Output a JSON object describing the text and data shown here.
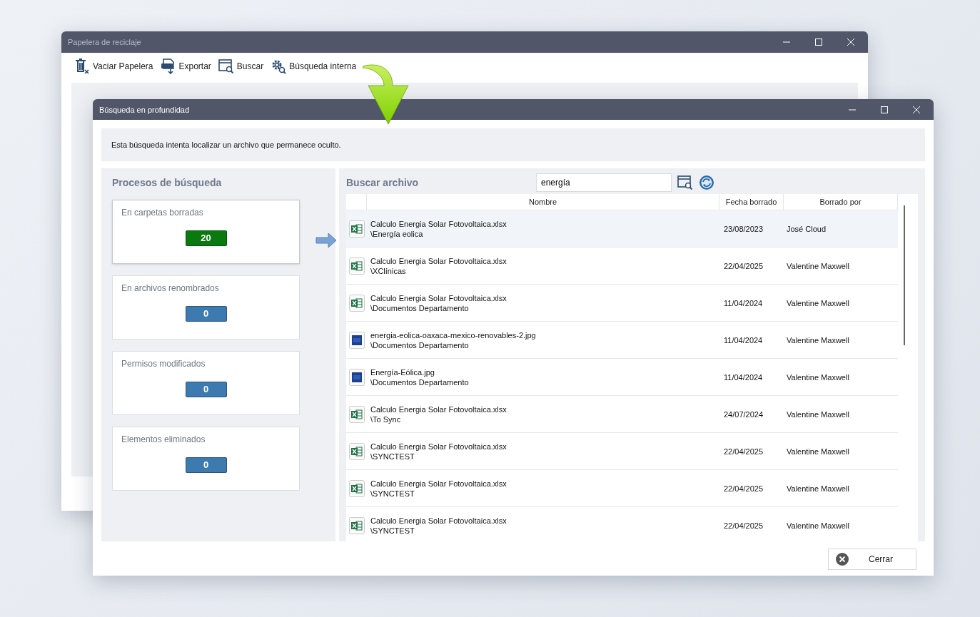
{
  "back_window": {
    "title": "Papelera de reciclaje",
    "toolbar": [
      {
        "kind": "trash",
        "label": "Vaciar Papelera"
      },
      {
        "kind": "csv",
        "label": "Exportar"
      },
      {
        "kind": "search",
        "label": "Buscar"
      },
      {
        "kind": "gear",
        "label": "Búsqueda interna"
      }
    ]
  },
  "dialog": {
    "title": "Búsqueda en profundidad",
    "info": "Esta búsqueda intenta localizar un archivo que permanece oculto.",
    "processes": {
      "title": "Procesos de búsqueda",
      "cards": [
        {
          "label": "En carpetas borradas",
          "count": "20",
          "color": "#0a7a10",
          "selected": true
        },
        {
          "label": "En archivos renombrados",
          "count": "0",
          "color": "#3c7ab0",
          "selected": false
        },
        {
          "label": "Permisos modificados",
          "count": "0",
          "color": "#3c7ab0",
          "selected": false
        },
        {
          "label": "Elementos eliminados",
          "count": "0",
          "color": "#3c7ab0",
          "selected": false
        }
      ]
    },
    "search": {
      "title": "Buscar archivo",
      "value": "energía"
    },
    "table": {
      "columns": [
        "Nombre",
        "Fecha borrado",
        "Borrado por"
      ],
      "rows": [
        {
          "kind": "excel",
          "name": "Calculo Energia Solar Fotovoltaica.xlsx",
          "path": "\\Energía eolica",
          "date": "23/08/2023",
          "by": "José Cloud",
          "selected": true
        },
        {
          "kind": "excel",
          "name": "Calculo Energia Solar Fotovoltaica.xlsx",
          "path": "\\XClínicas",
          "date": "22/04/2025",
          "by": "Valentine Maxwell",
          "selected": false
        },
        {
          "kind": "excel",
          "name": "Calculo Energia Solar Fotovoltaica.xlsx",
          "path": "\\Documentos Departamento",
          "date": "11/04/2024",
          "by": "Valentine Maxwell",
          "selected": false
        },
        {
          "kind": "photoshop",
          "name": "energia-eolica-oaxaca-mexico-renovables-2.jpg",
          "path": "\\Documentos Departamento",
          "date": "11/04/2024",
          "by": "Valentine Maxwell",
          "selected": false
        },
        {
          "kind": "photoshop",
          "name": "Energía-Eólica.jpg",
          "path": "\\Documentos Departamento",
          "date": "11/04/2024",
          "by": "Valentine Maxwell",
          "selected": false
        },
        {
          "kind": "excel",
          "name": "Calculo Energia Solar Fotovoltaica.xlsx",
          "path": "\\To Sync",
          "date": "24/07/2024",
          "by": "Valentine Maxwell",
          "selected": false
        },
        {
          "kind": "excel",
          "name": "Calculo Energia Solar Fotovoltaica.xlsx",
          "path": "\\SYNCTEST",
          "date": "22/04/2025",
          "by": "Valentine Maxwell",
          "selected": false
        },
        {
          "kind": "excel",
          "name": "Calculo Energia Solar Fotovoltaica.xlsx",
          "path": "\\SYNCTEST",
          "date": "22/04/2025",
          "by": "Valentine Maxwell",
          "selected": false
        },
        {
          "kind": "excel",
          "name": "Calculo Energia Solar Fotovoltaica.xlsx",
          "path": "\\SYNCTEST",
          "date": "22/04/2025",
          "by": "Valentine Maxwell",
          "selected": false
        }
      ]
    },
    "close_button": "Cerrar"
  }
}
